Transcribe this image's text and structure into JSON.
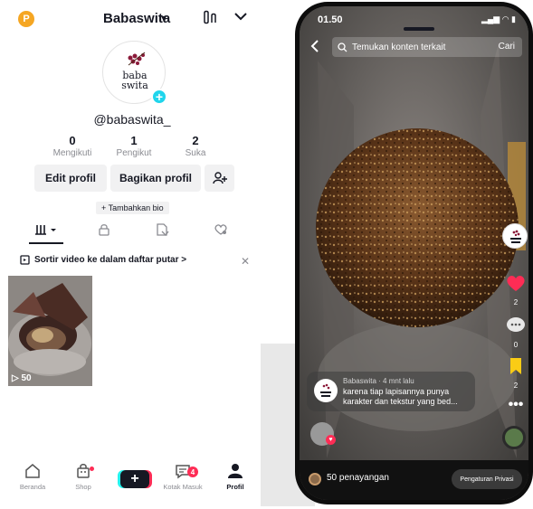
{
  "profile": {
    "badge_letter": "P",
    "account_name": "Babaswita",
    "username": "@babaswita_",
    "logo_line1": "baba",
    "logo_line2": "swita",
    "stats": [
      {
        "value": "0",
        "label": "Mengikuti"
      },
      {
        "value": "1",
        "label": "Pengikut"
      },
      {
        "value": "2",
        "label": "Suka"
      }
    ],
    "buttons": {
      "edit": "Edit profil",
      "share": "Bagikan profil"
    },
    "bio_label": "+ Tambahkan bio",
    "sort_text": "Sortir video ke dalam daftar putar >",
    "video": {
      "views": "50"
    }
  },
  "bottom_nav": {
    "items": [
      {
        "label": "Beranda"
      },
      {
        "label": "Shop"
      },
      {
        "label": "Kotak Masuk"
      },
      {
        "label": "Profil"
      }
    ],
    "inbox_count": "4"
  },
  "video_screen": {
    "status_time": "01.50",
    "search_placeholder": "Temukan konten terkait",
    "search_button": "Cari",
    "like_count": "2",
    "comment_count": "0",
    "save_count": "2",
    "caption_author": "Babaswita",
    "caption_time": "4 mnt lalu",
    "caption_text": "karena tiap lapisannya punya karakter dan tekstur yang bed...",
    "views_text": "50 penayangan",
    "privacy_button": "Pengaturan Privasi"
  },
  "colors": {
    "accent": "#fe2c55",
    "cyan": "#20d5ec",
    "badge": "#f5a623",
    "bookmark": "#facc15"
  }
}
